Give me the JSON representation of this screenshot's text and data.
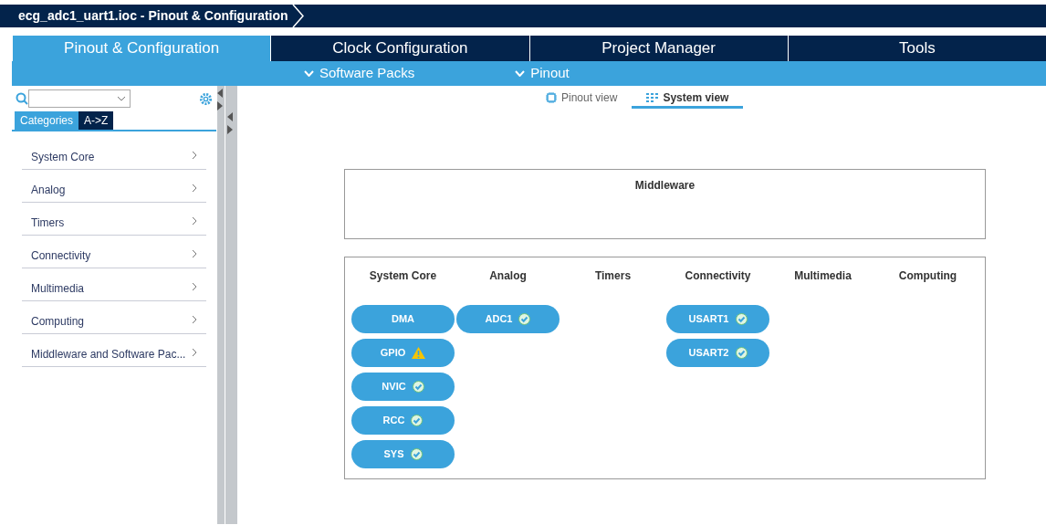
{
  "window": {
    "title": "ecg_adc1_uart1.ioc - Pinout & Configuration"
  },
  "tabs": [
    {
      "label": "Pinout & Configuration",
      "selected": true
    },
    {
      "label": "Clock Configuration",
      "selected": false
    },
    {
      "label": "Project Manager",
      "selected": false
    },
    {
      "label": "Tools",
      "selected": false
    }
  ],
  "menus": [
    "Software Packs",
    "Pinout"
  ],
  "sidebar": {
    "list_tabs": [
      {
        "label": "Categories",
        "selected": true
      },
      {
        "label": "A->Z",
        "selected": false
      }
    ],
    "items": [
      "System Core",
      "Analog",
      "Timers",
      "Connectivity",
      "Multimedia",
      "Computing",
      "Middleware and Software Pac..."
    ]
  },
  "view_tabs": [
    {
      "label": "Pinout view",
      "kind": "chip",
      "selected": false
    },
    {
      "label": "System view",
      "kind": "grid",
      "selected": true
    }
  ],
  "middleware": {
    "title": "Middleware"
  },
  "categories": [
    {
      "title": "System Core",
      "components": [
        {
          "label": "DMA",
          "kind": "plain"
        },
        {
          "label": "GPIO",
          "kind": "warning"
        },
        {
          "label": "NVIC",
          "kind": "ok"
        },
        {
          "label": "RCC",
          "kind": "ok"
        },
        {
          "label": "SYS",
          "kind": "ok"
        }
      ]
    },
    {
      "title": "Analog",
      "components": [
        {
          "label": "ADC1",
          "kind": "ok"
        }
      ]
    },
    {
      "title": "Timers"
    },
    {
      "title": "Connectivity",
      "components": [
        {
          "label": "USART1",
          "kind": "ok"
        },
        {
          "label": "USART2",
          "kind": "ok"
        }
      ]
    },
    {
      "title": "Multimedia"
    },
    {
      "title": "Computing"
    }
  ]
}
